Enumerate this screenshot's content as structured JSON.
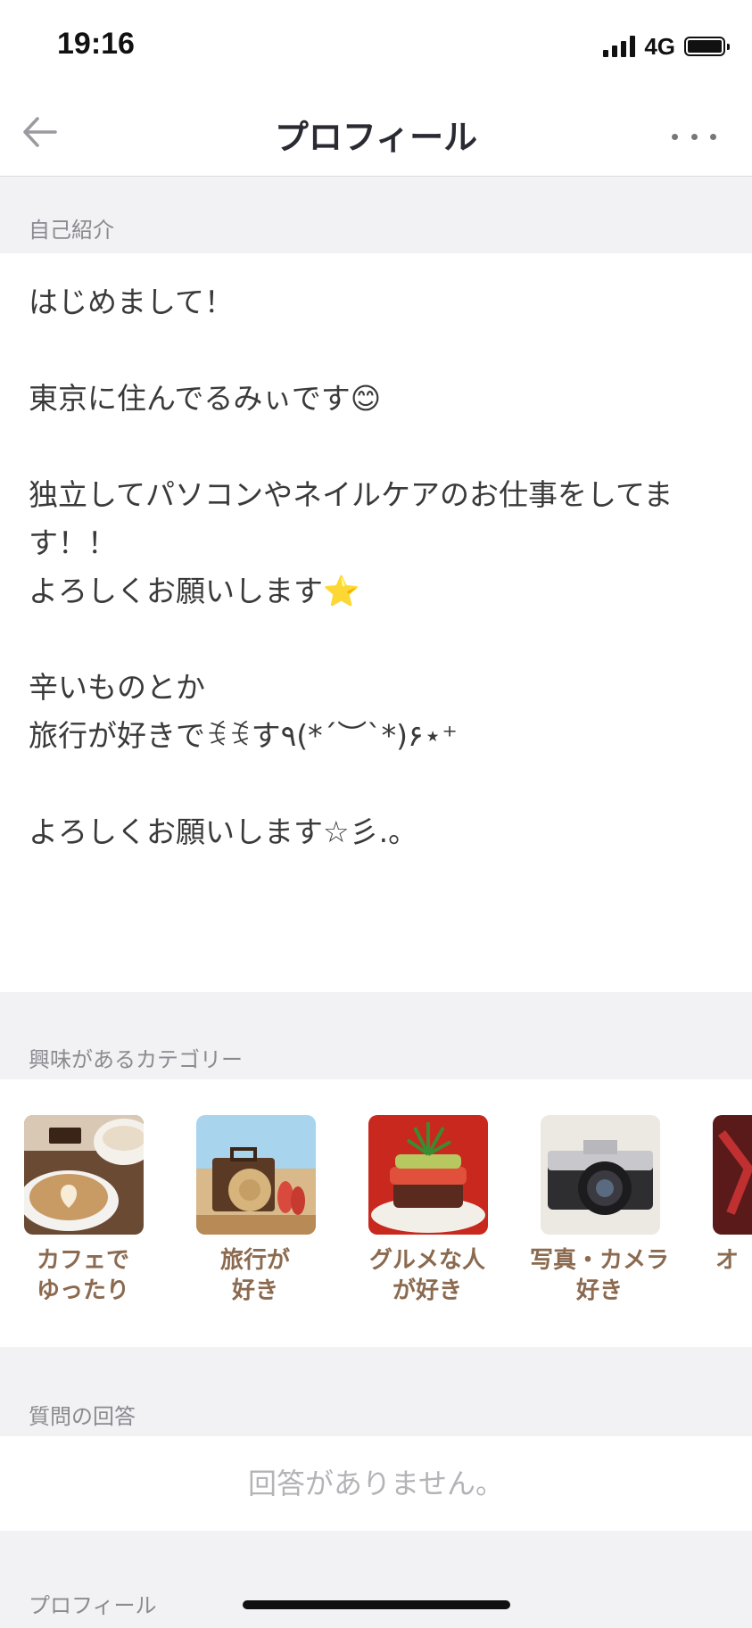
{
  "status_bar": {
    "time": "19:16",
    "network": "4G",
    "battery_level": 1.0
  },
  "nav": {
    "title": "プロフィール",
    "back_icon": "arrow-left-icon",
    "more_icon": "more-horizontal-icon"
  },
  "sections": {
    "intro_header": "自己紹介",
    "intro_text": "はじめまして！\n\n東京に住んでるみぃです😊\n\n独立してパソコンやネイルケアのお仕事をしてます！！\nよろしくお願いします⭐\n\n辛いものとか\n旅行が好きでꉂ⁠ꉂす٩(*´︶`*)۶⋆⁺\n\nよろしくお願いします☆彡.。",
    "categories_header": "興味があるカテゴリー",
    "answers_header": "質問の回答",
    "answers_empty": "回答がありません。",
    "profile_header": "プロフィール"
  },
  "categories": [
    {
      "label": "カフェで\nゆったり",
      "image": "cafe-latte-photo"
    },
    {
      "label": "旅行が\n好き",
      "image": "beach-travel-photo"
    },
    {
      "label": "グルメな人\nが好き",
      "image": "gourmet-dish-photo"
    },
    {
      "label": "写真・カメラ\n好き",
      "image": "camera-photo"
    },
    {
      "label": "オ",
      "image": "partial-photo"
    }
  ],
  "colors": {
    "category_label": "#8b6a4f",
    "section_background": "#f2f2f4",
    "placeholder_text": "#b4b4b8"
  }
}
